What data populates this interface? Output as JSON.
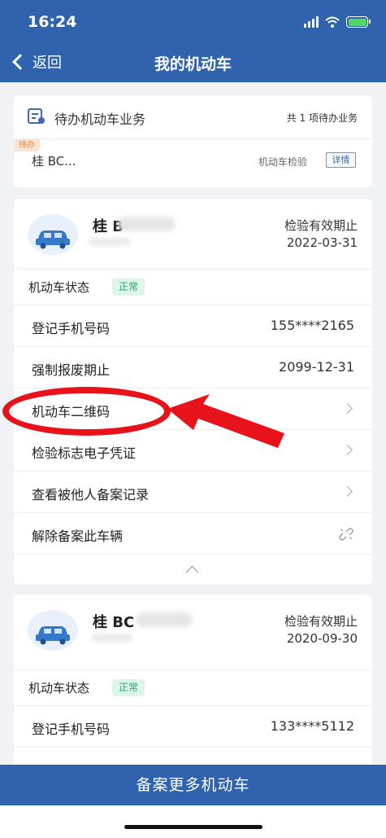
{
  "status": {
    "time": "16:24"
  },
  "nav": {
    "back_label": "返回",
    "title": "我的机动车"
  },
  "todo": {
    "title": "待办机动车业务",
    "count_text": "共 1 项待办业务",
    "tag": "待办",
    "plate": "桂 BC...",
    "business": "机动车检验",
    "detail_label": "详情"
  },
  "vehicles": [
    {
      "plate": "桂 B",
      "expiry_label": "检验有效期止",
      "expiry_date": "2022-03-31",
      "status_label": "机动车状态",
      "status_value": "正常",
      "rows": [
        {
          "label": "登记手机号码",
          "value": "155****2165"
        },
        {
          "label": "强制报废期止",
          "value": "2099-12-31"
        },
        {
          "label": "机动车二维码"
        },
        {
          "label": "检验标志电子凭证"
        },
        {
          "label": "查看被他人备案记录"
        },
        {
          "label": "解除备案此车辆"
        }
      ]
    },
    {
      "plate": "桂 BC",
      "expiry_label": "检验有效期止",
      "expiry_date": "2020-09-30",
      "status_label": "机动车状态",
      "status_value": "正常",
      "rows": [
        {
          "label": "登记手机号码",
          "value": "133****5112"
        }
      ]
    }
  ],
  "footer": {
    "button_label": "备案更多机动车"
  },
  "colors": {
    "primary": "#2f63ad",
    "ok_green": "#2aa66a",
    "annotation_red": "#e8121a"
  }
}
